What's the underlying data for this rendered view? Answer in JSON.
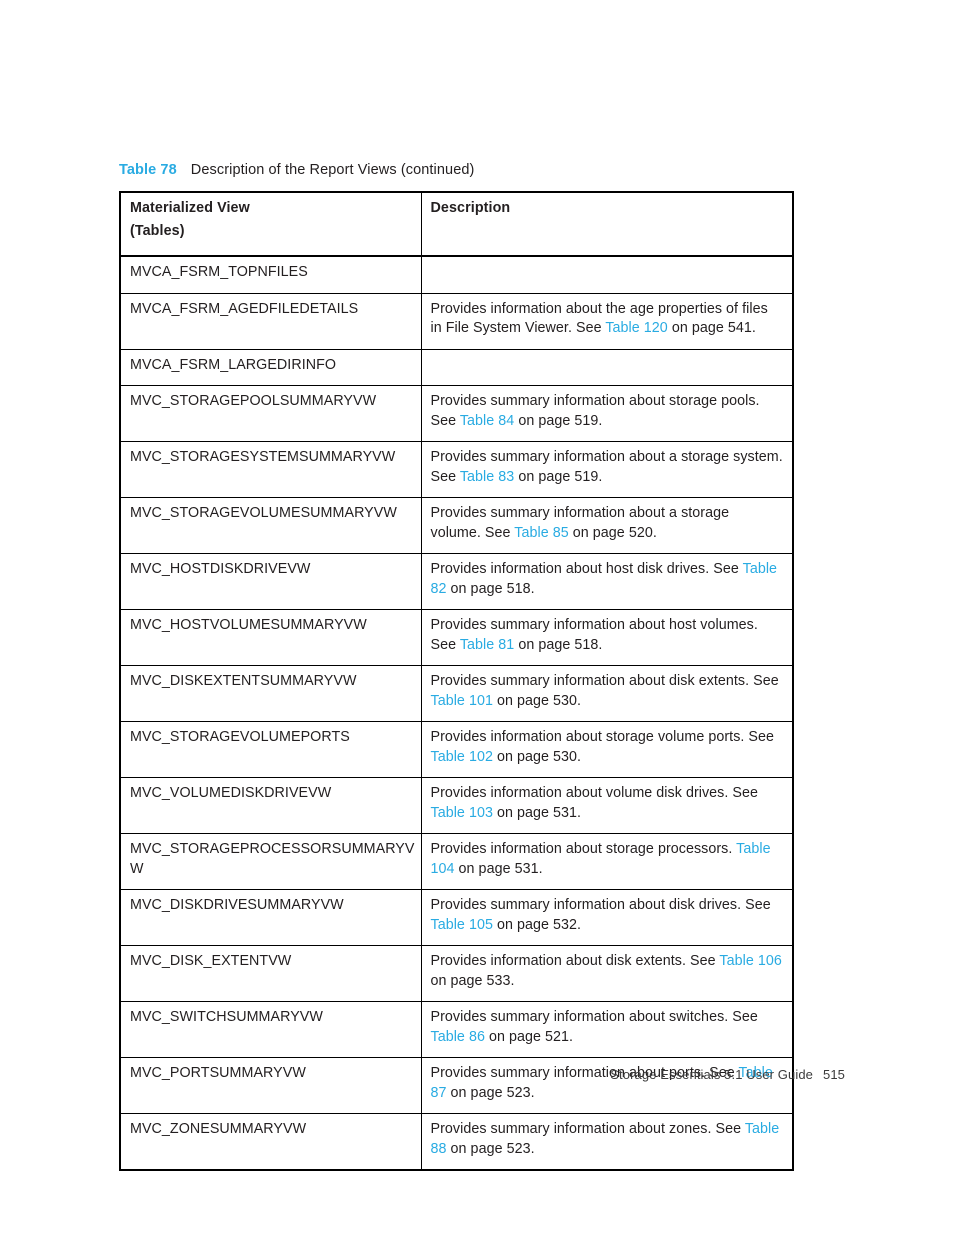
{
  "caption": {
    "label": "Table 78",
    "text": "Description of the Report Views (continued)",
    "label_color": "#29abe2"
  },
  "table": {
    "headers": {
      "col1_line1": "Materialized View",
      "col1_line2": "(Tables)",
      "col2": "Description"
    },
    "link_color": "#29abe2",
    "rows": [
      {
        "view": "MVCA_FSRM_TOPNFILES",
        "desc_pre": "",
        "xref": "",
        "desc_post": ""
      },
      {
        "view": "MVCA_FSRM_AGEDFILEDETAILS",
        "desc_pre": "Provides information about the age properties of files in File System Viewer. See ",
        "xref": "Table 120",
        "desc_post": " on page 541."
      },
      {
        "view": "MVCA_FSRM_LARGEDIRINFO",
        "desc_pre": "",
        "xref": "",
        "desc_post": ""
      },
      {
        "view": "MVC_STORAGEPOOLSUMMARYVW",
        "desc_pre": "Provides summary information about storage pools. See ",
        "xref": "Table 84",
        "desc_post": " on page 519."
      },
      {
        "view": "MVC_STORAGESYSTEMSUMMARYVW",
        "desc_pre": "Provides summary information about a storage system. See ",
        "xref": "Table 83",
        "desc_post": " on page 519."
      },
      {
        "view": "MVC_STORAGEVOLUMESUMMARYVW",
        "desc_pre": "Provides summary information about a storage volume. See ",
        "xref": "Table 85",
        "desc_post": " on page 520."
      },
      {
        "view": "MVC_HOSTDISKDRIVEVW",
        "desc_pre": "Provides information about host disk drives. See ",
        "xref": "Table 82",
        "desc_post": " on page 518."
      },
      {
        "view": "MVC_HOSTVOLUMESUMMARYVW",
        "desc_pre": "Provides summary information about host volumes. See ",
        "xref": "Table 81",
        "desc_post": " on page 518."
      },
      {
        "view": "MVC_DISKEXTENTSUMMARYVW",
        "desc_pre": "Provides summary information about disk extents. See ",
        "xref": "Table 101",
        "desc_post": " on page 530."
      },
      {
        "view": "MVC_STORAGEVOLUMEPORTS",
        "desc_pre": "Provides information about storage volume ports. See ",
        "xref": "Table 102",
        "desc_post": " on page 530."
      },
      {
        "view": "MVC_VOLUMEDISKDRIVEVW",
        "desc_pre": "Provides information about volume disk drives. See ",
        "xref": "Table 103",
        "desc_post": " on page 531."
      },
      {
        "view": "MVC_STORAGEPROCESSORSUMMARYVW",
        "desc_pre": "Provides information about storage processors. ",
        "xref": "Table 104",
        "desc_post": " on page 531."
      },
      {
        "view": "MVC_DISKDRIVESUMMARYVW",
        "desc_pre": "Provides summary information about disk drives. See ",
        "xref": "Table 105",
        "desc_post": " on page 532."
      },
      {
        "view": "MVC_DISK_EXTENTVW",
        "desc_pre": "Provides information about disk extents. See ",
        "xref": "Table 106",
        "desc_post": " on page 533."
      },
      {
        "view": "MVC_SWITCHSUMMARYVW",
        "desc_pre": "Provides summary information about switches. See ",
        "xref": "Table 86",
        "desc_post": " on page 521."
      },
      {
        "view": "MVC_PORTSUMMARYVW",
        "desc_pre": "Provides summary information about ports. See ",
        "xref": "Table 87",
        "desc_post": " on page 523."
      },
      {
        "view": "MVC_ZONESUMMARYVW",
        "desc_pre": "Provides summary information about zones. See ",
        "xref": "Table 88",
        "desc_post": " on page 523."
      }
    ]
  },
  "footer": {
    "title": "Storage Essentials 5.1 User Guide",
    "page_number": "515"
  }
}
